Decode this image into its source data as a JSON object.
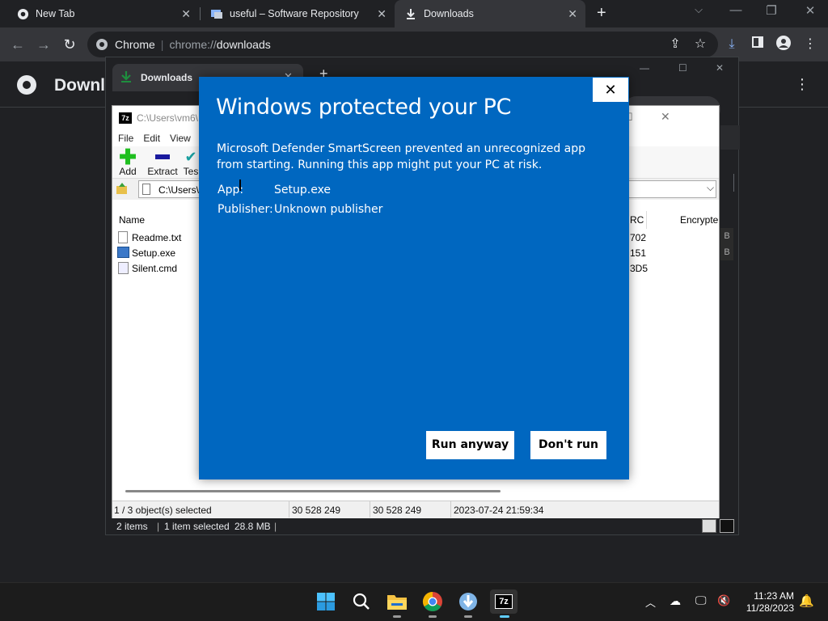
{
  "browser": {
    "tabs": [
      {
        "title": "New Tab"
      },
      {
        "title": "useful – Software Repository"
      },
      {
        "title": "Downloads"
      }
    ],
    "omnibox": {
      "site_label": "Chrome",
      "url_scheme": "chrome://",
      "url_host": "downloads"
    }
  },
  "downloads_page": {
    "title": "Downl"
  },
  "inner_window": {
    "tab_title": "Downloads",
    "status_items": "2 items",
    "status_selected": "1 item selected",
    "status_size": "28.8 MB"
  },
  "sevenzip": {
    "title": "C:\\Users\\vm6\\",
    "menu": [
      "File",
      "Edit",
      "View"
    ],
    "tools": [
      {
        "label": "Add"
      },
      {
        "label": "Extract"
      },
      {
        "label": "Tes"
      }
    ],
    "address": "C:\\Users\\",
    "columns": {
      "name": "Name",
      "crc": "RC",
      "encrypted": "Encrypte"
    },
    "files": [
      {
        "name": "Readme.txt",
        "crc": "702",
        "right": "B"
      },
      {
        "name": "Setup.exe",
        "crc": "151",
        "right": "B"
      },
      {
        "name": "Silent.cmd",
        "crc": "3D5",
        "right": ""
      }
    ],
    "status": {
      "selection": "1 / 3 object(s) selected",
      "size": "30 528 249",
      "packed": "30 528 249",
      "modified": "2023-07-24 21:59:34"
    }
  },
  "smartscreen": {
    "title": "Windows protected your PC",
    "description": "Microsoft Defender SmartScreen prevented an unrecognized app from starting. Running this app might put your PC at risk.",
    "app_label": "App:",
    "app_value": "Setup.exe",
    "publisher_label": "Publisher:",
    "publisher_value": "Unknown publisher",
    "run_anyway": "Run anyway",
    "dont_run": "Don't run",
    "close_glyph": "✕"
  },
  "taskbar": {
    "time": "11:23 AM",
    "date": "11/28/2023"
  },
  "colors": {
    "smartscreen_blue": "#0067c0",
    "chrome_dark": "#202124",
    "chrome_toolbar": "#35363a",
    "download_accent": "#8ab4f8"
  }
}
